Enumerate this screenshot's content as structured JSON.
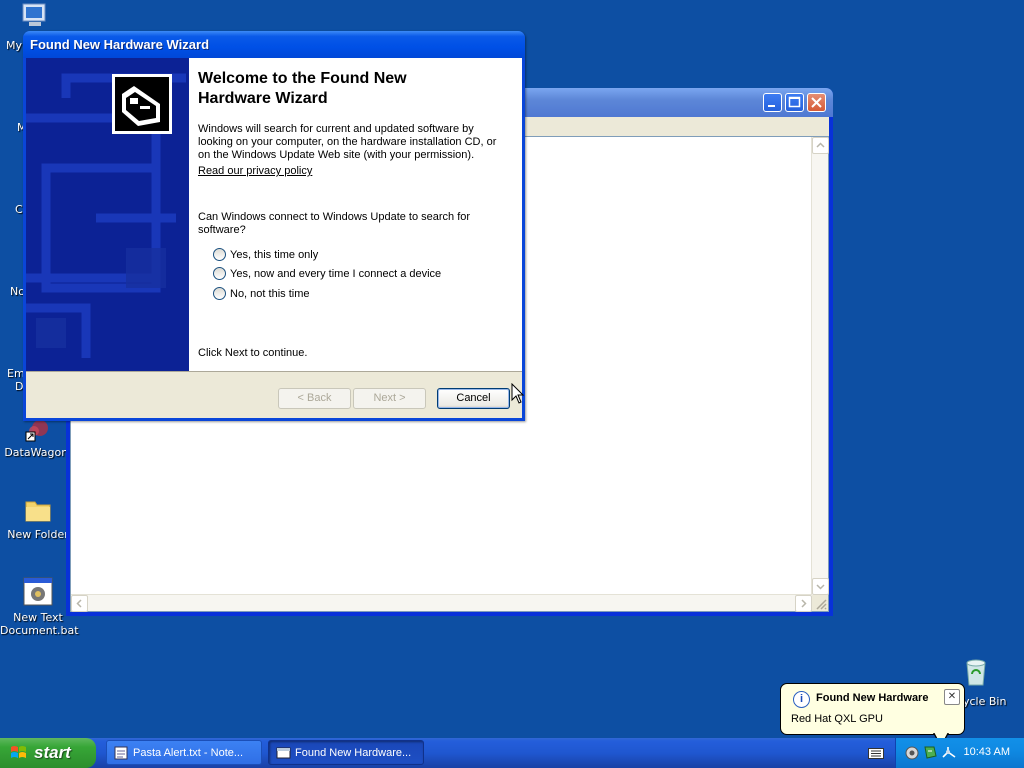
{
  "desktop": {
    "clipped_labels": [
      "My",
      "M",
      "C",
      "No",
      "Em",
      "D"
    ],
    "icons": [
      {
        "label": "DataWagon."
      },
      {
        "label": "New Folder"
      },
      {
        "label": "New Text Document.bat"
      },
      {
        "label": "ycle Bin"
      }
    ]
  },
  "wizard": {
    "title": "Found New Hardware Wizard",
    "heading": "Welcome to the Found New Hardware Wizard",
    "intro": "Windows will search for current and updated software by looking on your computer, on the hardware installation CD, or on the Windows Update Web site (with your permission).",
    "privacy_link": "Read our privacy policy",
    "question": "Can Windows connect to Windows Update to search for software?",
    "options": [
      {
        "label": "Yes, this time only",
        "selected": false
      },
      {
        "label": "Yes, now and every time I connect a device",
        "selected": false
      },
      {
        "label": "No, not this time",
        "selected": false
      }
    ],
    "footer_text": "Click Next to continue.",
    "buttons": {
      "back": "< Back",
      "next": "Next >",
      "cancel": "Cancel"
    }
  },
  "taskbar": {
    "start_label": "start",
    "items": [
      {
        "label": "Pasta Alert.txt - Note...",
        "active": false
      },
      {
        "label": "Found New Hardware...",
        "active": true
      }
    ],
    "clock": "10:43 AM"
  },
  "balloon": {
    "title": "Found New Hardware",
    "message": "Red Hat QXL GPU",
    "close": "✕",
    "info_glyph": "i"
  },
  "colors": {
    "desktop": "#0d4fa3",
    "title_bar": "#0050e6",
    "start_green": "#37a637",
    "tray_blue": "#0f8ae3"
  }
}
